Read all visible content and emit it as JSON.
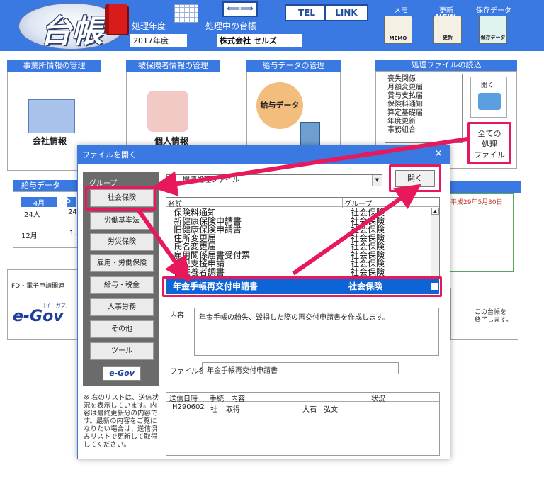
{
  "header": {
    "logo": "台帳",
    "fiscal_year_label": "処理年度",
    "fiscal_year_value": "2017年度",
    "ledger_label": "処理中の台帳",
    "ledger_value": "株式会社 セルズ",
    "arrow_btn": "⟸⟹",
    "tel": "TEL",
    "link": "LINK",
    "memo_label": "メモ",
    "memo_icon": "MEMO",
    "update_label": "更新",
    "update_icon": "更新",
    "new_badge": "NEW",
    "save_label": "保存データ",
    "save_icon": "保存データ"
  },
  "panels": {
    "office_title": "事業所情報の管理",
    "office_card": "会社情報",
    "insured_title": "被保険者情報の管理",
    "insured_card": "個人情報",
    "salary_title": "給与データの管理",
    "salary_card": "給与データ",
    "proc_title": "処理ファイルの読込",
    "proc_list": [
      "喪失関係",
      "月額変更届",
      "賞与支払届",
      "保険料通知",
      "算定基礎届",
      "年度更新",
      "事務組合"
    ],
    "proc_open": "開く",
    "all_files": [
      "全ての",
      "処理",
      "ファイル"
    ],
    "salary_mini_title": "給与データ",
    "salary_months": [
      "4月",
      "5"
    ],
    "salary_counts": [
      "24人",
      "24"
    ],
    "salary_months2": [
      "12月",
      "1."
    ],
    "fd_label": "FD・電子申請関連",
    "egov": "e-Gov",
    "egov_sup": "[イーガブ]",
    "right_date": "平成29年5月30日",
    "close_note": [
      "この台帳を",
      "終了します。"
    ]
  },
  "dialog": {
    "title": "ファイルを開く",
    "close": "✕",
    "group_label": "グループ",
    "groups": [
      "社会保険",
      "労働基準法",
      "労災保険",
      "雇用・労働保険",
      "給与・税金",
      "人事労務",
      "その他",
      "ツール"
    ],
    "egov": "e-Gov",
    "combo_value": "関連処理ファイル",
    "open_button": "開く",
    "col_name": "名前",
    "col_group": "グループ",
    "rows": [
      {
        "name": "保険料通知",
        "group": "社会保険"
      },
      {
        "name": "新健康保険申請書",
        "group": "社会保険"
      },
      {
        "name": "旧健康保険申請書",
        "group": "社会保険"
      },
      {
        "name": "住所変更届",
        "group": "社会保険"
      },
      {
        "name": "氏名変更届",
        "group": "社会保険"
      },
      {
        "name": "雇用関係届書受付票",
        "group": "社会保険"
      },
      {
        "name": "育児支援申請",
        "group": "社会保険"
      },
      {
        "name": "被扶養者調書",
        "group": "社会保険"
      }
    ],
    "selected": {
      "name": "年金手帳再交付申請書",
      "group": "社会保険"
    },
    "content_label": "内容",
    "content_text": "年金手帳の紛失、毀損した際の再交付申請書を作成します。",
    "filename_label": "ファイル名",
    "filename_value": "年金手帳再交付申請書",
    "note": "※ 右のリストは、送信状況を表示しています。内容は最終更新分の内容です。最新の内容をご覧になりたい場合は、送信済みリストで更新して取得してください。",
    "hist_cols": [
      "送信日時",
      "手続",
      "内容",
      "状況"
    ],
    "hist_row": [
      "H290602",
      "社",
      "取得",
      "大石　弘文"
    ]
  },
  "colors": {
    "accent": "#3a78e2",
    "highlight": "#e8195a",
    "selection": "#0c64d6"
  }
}
